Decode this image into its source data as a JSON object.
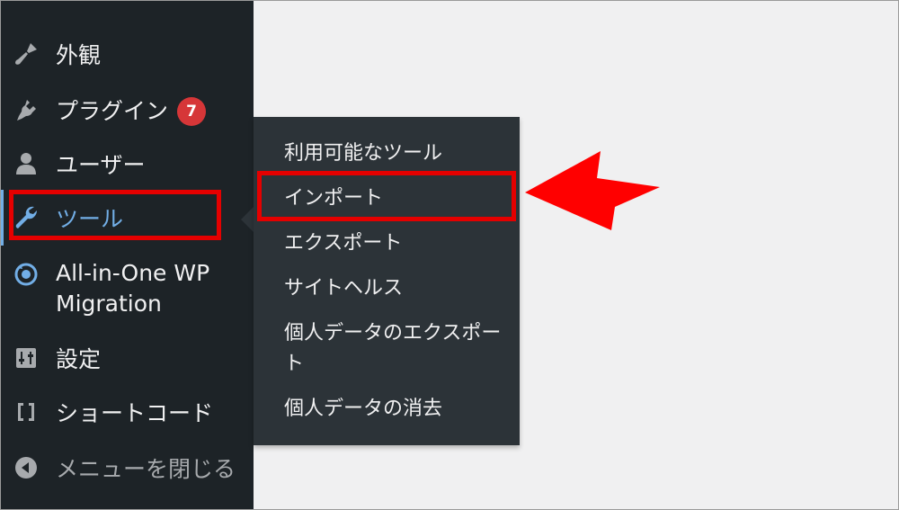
{
  "sidebar": {
    "items": [
      {
        "id": "appearance",
        "label": "外観",
        "icon": "paintbrush-icon"
      },
      {
        "id": "plugins",
        "label": "プラグイン",
        "icon": "plug-icon",
        "badge": "7"
      },
      {
        "id": "users",
        "label": "ユーザー",
        "icon": "user-icon"
      },
      {
        "id": "tools",
        "label": "ツール",
        "icon": "wrench-icon",
        "current": true
      },
      {
        "id": "aio",
        "label": "All-in-One WP Migration",
        "icon": "migration-icon"
      },
      {
        "id": "settings",
        "label": "設定",
        "icon": "settings-sliders-icon"
      },
      {
        "id": "shortcode",
        "label": "ショートコード",
        "icon": "brackets-icon"
      },
      {
        "id": "collapse",
        "label": "メニューを閉じる",
        "icon": "collapse-arrow-icon"
      }
    ]
  },
  "submenu": {
    "items": [
      {
        "id": "available",
        "label": "利用可能なツール"
      },
      {
        "id": "import",
        "label": "インポート"
      },
      {
        "id": "export",
        "label": "エクスポート"
      },
      {
        "id": "health",
        "label": "サイトヘルス"
      },
      {
        "id": "privacy-export",
        "label": "個人データのエクスポート"
      },
      {
        "id": "privacy-erase",
        "label": "個人データの消去"
      }
    ]
  },
  "colors": {
    "sidebar_bg": "#1d2327",
    "submenu_bg": "#2c3338",
    "accent": "#72aee6",
    "badge": "#d63638",
    "annotation": "#e50000",
    "page_bg": "#f0f0f1"
  }
}
